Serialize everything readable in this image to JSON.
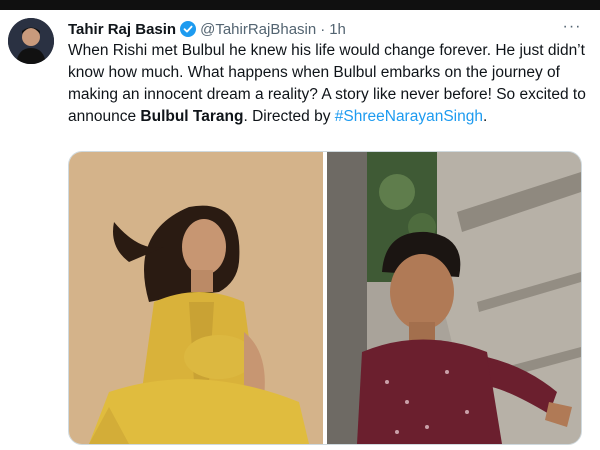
{
  "tweet": {
    "author_name": "Tahir Raj Basin",
    "handle": "@TahirRajBhasin",
    "separator": "·",
    "time": "1h",
    "more": "···",
    "text_part1": "When Rishi met Bulbul he knew his life would change forever. He just didn’t know how much. What happens when Bulbul embarks on the journey of making an innocent dream a reality? A story like never before! So excited to announce ",
    "text_bold": "Bulbul Tarang",
    "text_part2": ". Directed by ",
    "hashtag": "#ShreeNarayanSingh",
    "text_end": "."
  },
  "icons": {
    "avatar": "avatar",
    "verified": "verified-badge-icon",
    "more": "more-options-icon"
  },
  "colors": {
    "link": "#1d9bf0",
    "secondary_text": "#536471",
    "verified": "#1d9bf0"
  }
}
